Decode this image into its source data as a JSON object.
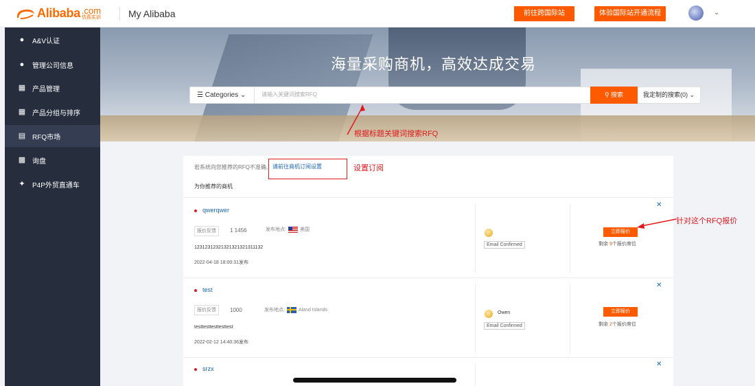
{
  "header": {
    "logo_text": "Alibaba",
    "logo_com": ".com",
    "logo_cn": "仿真实训",
    "title": "My Alibaba",
    "btn_intl": "前往跨国际站",
    "btn_flow": "体验国际站开通流程"
  },
  "sidebar": {
    "items": [
      {
        "label": "A&V认证"
      },
      {
        "label": "管理公司信息"
      },
      {
        "label": "产品管理"
      },
      {
        "label": "产品分组与排序"
      },
      {
        "label": "RFQ市场"
      },
      {
        "label": "询盘"
      },
      {
        "label": "P4P外贸直通车"
      }
    ]
  },
  "banner": {
    "title": "海量采购商机，高效达成交易",
    "categories": "Categories",
    "search_placeholder": "请输入关键词搜索RFQ",
    "search_button": "搜索",
    "custom_search": "我定制的搜索(0)"
  },
  "annotations": {
    "search": "根据标题关键词搜索RFQ",
    "subscribe": "设置订阅",
    "quote": "针对这个RFQ报价"
  },
  "panel": {
    "notice": "若系统向您推荐的RFQ不准确,",
    "subscribe_link": "请前往商机订阅设置",
    "recommended_title": "为你推荐的商机"
  },
  "rfqs": [
    {
      "title": "qwerqwer",
      "badge": "报价反馈",
      "quantity": "1 1456",
      "origin_label": "发布地点:",
      "country": "美国",
      "description": "12312312321321321321311132",
      "date": "2022-04-18 18:00:31发布",
      "buyer": "",
      "email": "Email Confirmed",
      "quote_button": "立即报价",
      "remain_prefix": "剩余",
      "remain_count": "9",
      "remain_suffix": "个报价席位"
    },
    {
      "title": "test",
      "badge": "报价反馈",
      "quantity": "1000",
      "origin_label": "发布地点:",
      "country": "Aland Islands",
      "description": "testtesttesttesttest",
      "date": "2022-02-12 14:40:36发布",
      "buyer": "Owen",
      "email": "Email Confirmed",
      "quote_button": "立即报价",
      "remain_prefix": "剩余",
      "remain_count": "2",
      "remain_suffix": "个报价席位"
    },
    {
      "title": "srzx"
    }
  ],
  "icons": {
    "close": "close-icon",
    "chevron": "chevron-down-icon",
    "search": "search-icon"
  },
  "colors": {
    "accent": "#ff5a00",
    "sidebar": "#262d3d",
    "link": "#1a66b3",
    "annotation": "#e0191e"
  }
}
